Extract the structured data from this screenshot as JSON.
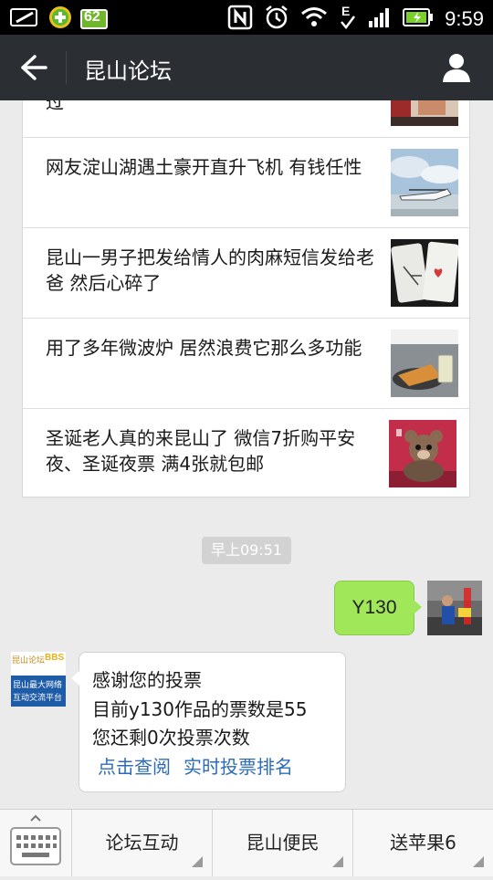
{
  "status_bar": {
    "battery_percent": "62",
    "time": "9:59",
    "icons": [
      "sim-icon",
      "plus-app-icon",
      "battery-badge-icon",
      "nfc-icon",
      "alarm-icon",
      "wifi-icon",
      "data-e-icon",
      "signal-icon",
      "battery-icon"
    ]
  },
  "header": {
    "title": "昆山论坛",
    "back_icon": "back-arrow-icon",
    "profile_icon": "person-icon"
  },
  "news": {
    "partial_item": "过",
    "items": [
      {
        "title": "网友淀山湖遇土豪开直升飞机 有钱任性"
      },
      {
        "title": "昆山一男子把发给情人的肉麻短信发给老爸 然后心碎了"
      },
      {
        "title": "用了多年微波炉 居然浪费它那么多功能"
      },
      {
        "title": "圣诞老人真的来昆山了 微信7折购平安夜、圣诞夜票 满4张就包邮"
      }
    ]
  },
  "chat": {
    "timestamp": "早上09:51",
    "outgoing": "Y130",
    "incoming": {
      "line1": "感谢您的投票",
      "line2": "目前y130作品的票数是55",
      "line3": "您还剩0次投票次数",
      "link1": "点击查阅",
      "link2": "实时投票排名"
    },
    "bbs_avatar": {
      "line1": "昆山论坛",
      "tag": "BBS",
      "line2": "昆山最大网络",
      "line3": "互动交流平台"
    }
  },
  "menu": {
    "keyboard_icon": "keyboard-icon",
    "items": [
      {
        "label": "论坛互动"
      },
      {
        "label": "昆山便民"
      },
      {
        "label": "送苹果6"
      }
    ]
  },
  "colors": {
    "titlebar": "#2b2f33",
    "outgoing_bubble": "#a0e75a",
    "link": "#2d6cb5"
  }
}
